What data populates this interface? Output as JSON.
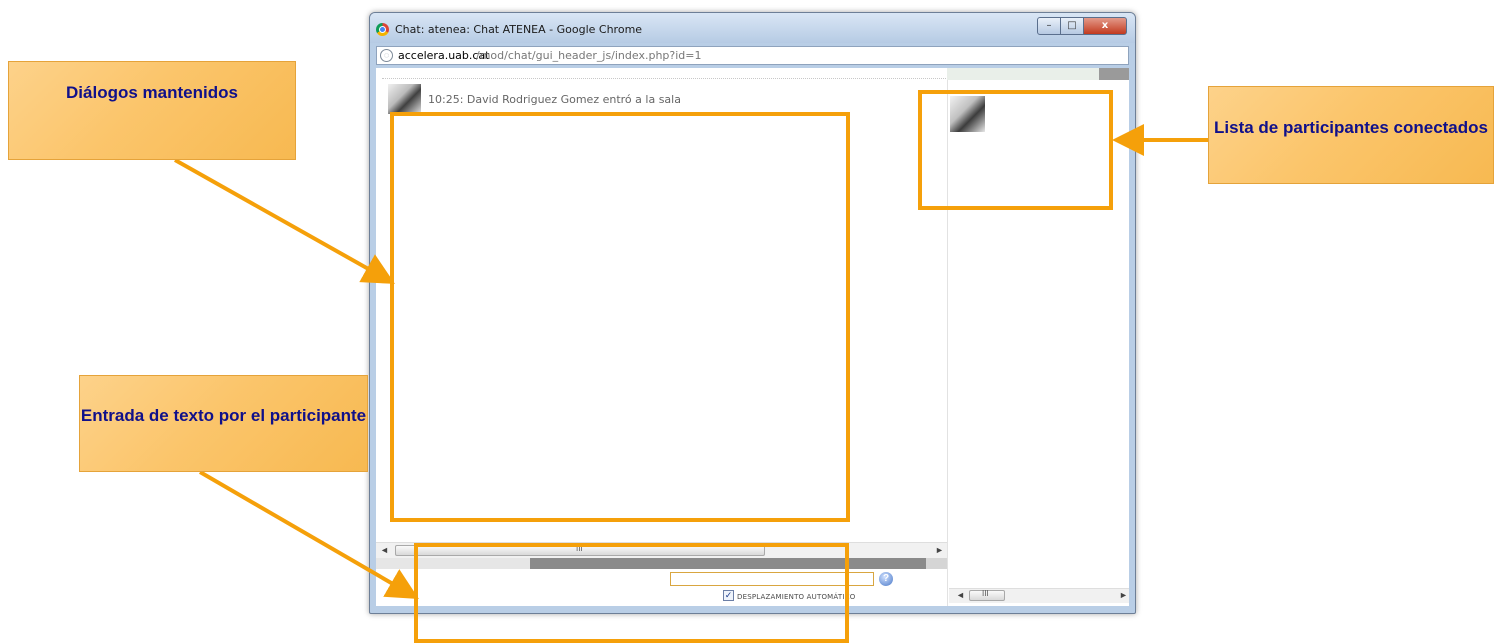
{
  "window": {
    "title": "Chat: atenea: Chat ATENEA - Google Chrome",
    "controls": {
      "minimize": "–",
      "maximize": "□",
      "close": "x"
    }
  },
  "address_bar": {
    "host": "accelera.uab.cat",
    "path": "/mod/chat/gui_header_js/index.php?id=1"
  },
  "chat": {
    "messages": [
      {
        "text": "10:25: David Rodriguez Gomez entró a la sala"
      }
    ],
    "input_value": "",
    "autoscroll_label": "DESPLAZAMIENTO AUTOMÁTICO",
    "autoscroll_checked": true,
    "scroll_grip": "III"
  },
  "annotations": {
    "dialogs": "Diálogos mantenidos",
    "participants": "Lista de participantes conectados",
    "entry": "Entrada de texto por el participante",
    "accent_color": "#f5a00a",
    "text_color": "#10108a"
  }
}
